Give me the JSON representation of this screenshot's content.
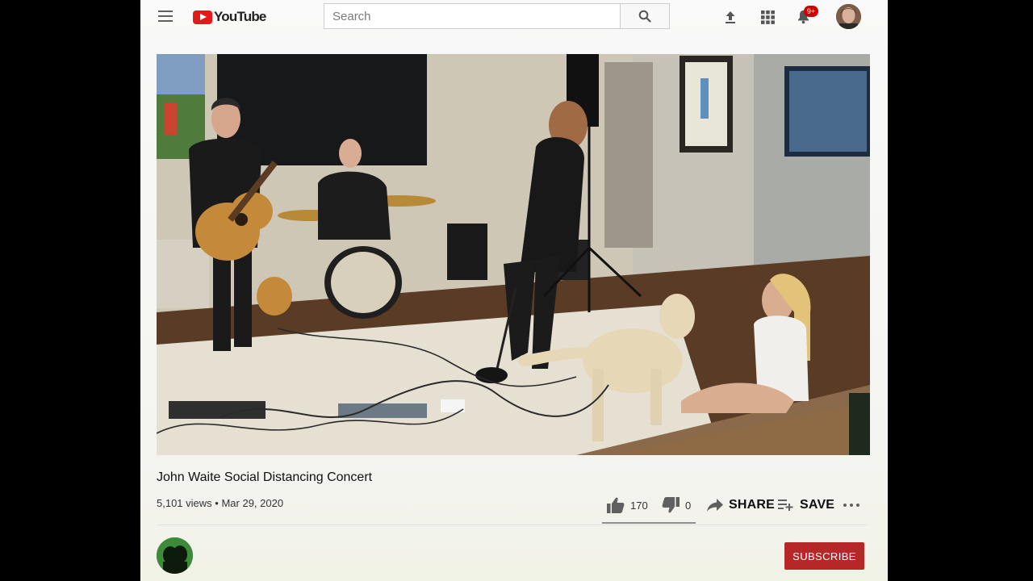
{
  "header": {
    "logo_text": "YouTube",
    "search_placeholder": "Search",
    "notification_count": "9+",
    "icons": [
      "menu-icon",
      "youtube-logo-icon",
      "search-icon",
      "upload-icon",
      "apps-icon",
      "bell-icon",
      "avatar"
    ]
  },
  "video": {
    "title": "John Waite Social Distancing Concert",
    "views": "5,101 views",
    "separator": "•",
    "date": "Mar 29, 2020",
    "likes": "170",
    "dislikes": "0",
    "share_label": "SHARE",
    "save_label": "SAVE",
    "like_ratio": 1.0
  },
  "channel": {
    "subscribe_label": "SUBSCRIBE"
  },
  "colors": {
    "brand_red": "#e31a1a",
    "subscribe_red": "#b62727",
    "badge_red": "#cc0000"
  }
}
